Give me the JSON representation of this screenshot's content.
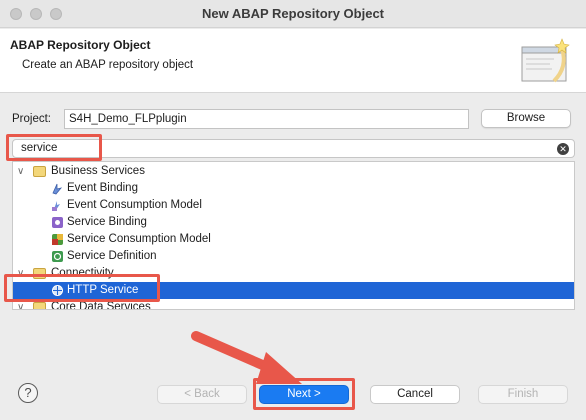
{
  "window": {
    "title": "New ABAP Repository Object"
  },
  "header": {
    "title": "ABAP Repository Object",
    "description": "Create an ABAP repository object"
  },
  "project": {
    "label": "Project:",
    "value": "S4H_Demo_FLPplugin",
    "browse_label": "Browse"
  },
  "search": {
    "value": "service"
  },
  "tree": {
    "groups": [
      {
        "label": "Business Services",
        "expanded": true,
        "items": [
          {
            "label": "Event Binding",
            "icon": "event-binding-icon"
          },
          {
            "label": "Event Consumption Model",
            "icon": "event-consumption-model-icon"
          },
          {
            "label": "Service Binding",
            "icon": "service-binding-icon"
          },
          {
            "label": "Service Consumption Model",
            "icon": "service-consumption-model-icon"
          },
          {
            "label": "Service Definition",
            "icon": "service-definition-icon"
          }
        ]
      },
      {
        "label": "Connectivity",
        "expanded": true,
        "items": [
          {
            "label": "HTTP Service",
            "icon": "http-service-icon",
            "selected": true
          }
        ]
      },
      {
        "label": "Core Data Services",
        "expanded": true,
        "items": []
      }
    ]
  },
  "footer": {
    "help": "?",
    "back_label": "< Back",
    "next_label": "Next >",
    "cancel_label": "Cancel",
    "finish_label": "Finish"
  },
  "colors": {
    "selection": "#1f65d6",
    "primary_button": "#1a7bf2",
    "annotation": "#e8574a"
  }
}
